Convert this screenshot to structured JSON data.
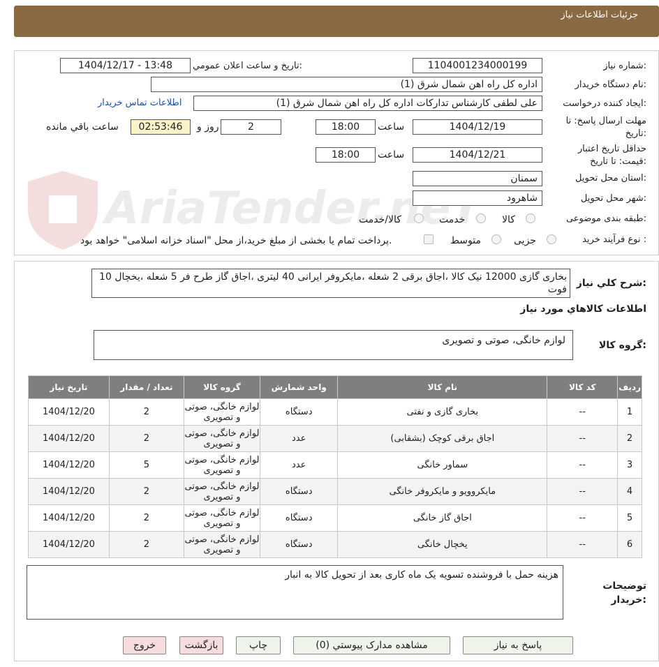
{
  "header": {
    "title": "جزئیات اطلاعات نیاز"
  },
  "form": {
    "need_number_label": "شماره نیاز:",
    "need_number": "1104001234000199",
    "announce_label": "تاریخ و ساعت اعلان عمومي:",
    "announce_value": "1404/12/17 - 13:48",
    "buyer_label": "نام دستگاه خریدار:",
    "buyer_value": "اداره کل راه اهن شمال شرق (1)",
    "creator_label": "ایجاد کننده درخواست:",
    "creator_value": "علی لطفی کارشناس تدارکات اداره کل راه اهن شمال شرق (1)",
    "contact_link": "اطلاعات تماس خریدار",
    "deadline_label": "مهلت ارسال پاسخ: تا تاریخ:",
    "deadline_date": "1404/12/19",
    "time_label": "ساعت",
    "deadline_time": "18:00",
    "days_value": "2",
    "days_label": "روز و",
    "remaining_value": "02:53:46",
    "remaining_label": "ساعت باقي مانده",
    "validity_label": "حداقل تاریخ اعتبار قیمت: تا تاریخ:",
    "validity_date": "1404/12/21",
    "validity_time": "18:00",
    "province_label": "استان محل تحویل:",
    "province_value": "سمنان",
    "city_label": "شهر محل تحویل:",
    "city_value": "شاهرود",
    "category_label": "طبقه بندی موضوعی:",
    "category_options": [
      "کالا",
      "خدمت",
      "کالا/خدمت"
    ],
    "process_label": "نوع فرآیند خرید :",
    "process_options": [
      "جزیی",
      "متوسط"
    ],
    "payment_note": "پرداخت تمام یا بخشی از مبلغ خرید،از محل \"اسناد خزانه اسلامی\" خواهد بود."
  },
  "summary": {
    "label": "شرح کلي نياز:",
    "text": "بخاری گازی 12000 نیک کالا ،اجاق برقی 2 شعله ،مایکروفر ایرانی 40 لیتری ،اجاق گاز طرح فر 5 شعله ،یخچال 10 فوت",
    "items_title": "اطلاعات کالاهاي مورد نياز",
    "group_label": "گروه کالا:",
    "group_value": "لوازم خانگی، صوتی و تصویری"
  },
  "table": {
    "headers": [
      "ردیف",
      "کد کالا",
      "نام کالا",
      "واحد شمارش",
      "گروه کالا",
      "تعداد / مقدار",
      "تاریخ نیاز"
    ],
    "rows": [
      [
        "1",
        "--",
        "بخاری گازی و نفتی",
        "دستگاه",
        "لوازم خانگی، صوتی و تصویری",
        "2",
        "1404/12/20"
      ],
      [
        "2",
        "--",
        "اجاق برقی کوچک (بشقابی)",
        "عدد",
        "لوازم خانگی، صوتی و تصویری",
        "2",
        "1404/12/20"
      ],
      [
        "3",
        "--",
        "سماور خانگی",
        "عدد",
        "لوازم خانگی، صوتی و تصویری",
        "5",
        "1404/12/20"
      ],
      [
        "4",
        "--",
        "مایکروویو و مایکروفر خانگی",
        "دستگاه",
        "لوازم خانگی، صوتی و تصویری",
        "2",
        "1404/12/20"
      ],
      [
        "5",
        "--",
        "اجاق گاز خانگی",
        "دستگاه",
        "لوازم خانگی، صوتی و تصویری",
        "2",
        "1404/12/20"
      ],
      [
        "6",
        "--",
        "یخچال خانگی",
        "دستگاه",
        "لوازم خانگی، صوتی و تصویری",
        "2",
        "1404/12/20"
      ]
    ]
  },
  "notes": {
    "label": "توضیحات خریدار:",
    "text": "هزینه حمل با فروشنده تسویه یک ماه کاری بعد از تحویل کالا به انبار"
  },
  "buttons": {
    "reply": "پاسخ به نیاز",
    "docs": "مشاهده مدارک پیوستي (0)",
    "print": "چاپ",
    "back": "بازگشت",
    "exit": "خروج"
  },
  "watermark": "AriaTender.neT",
  "colors": {
    "header": "#8a6a40",
    "link": "#1a4fb0",
    "table_header": "#7f7f7f"
  }
}
